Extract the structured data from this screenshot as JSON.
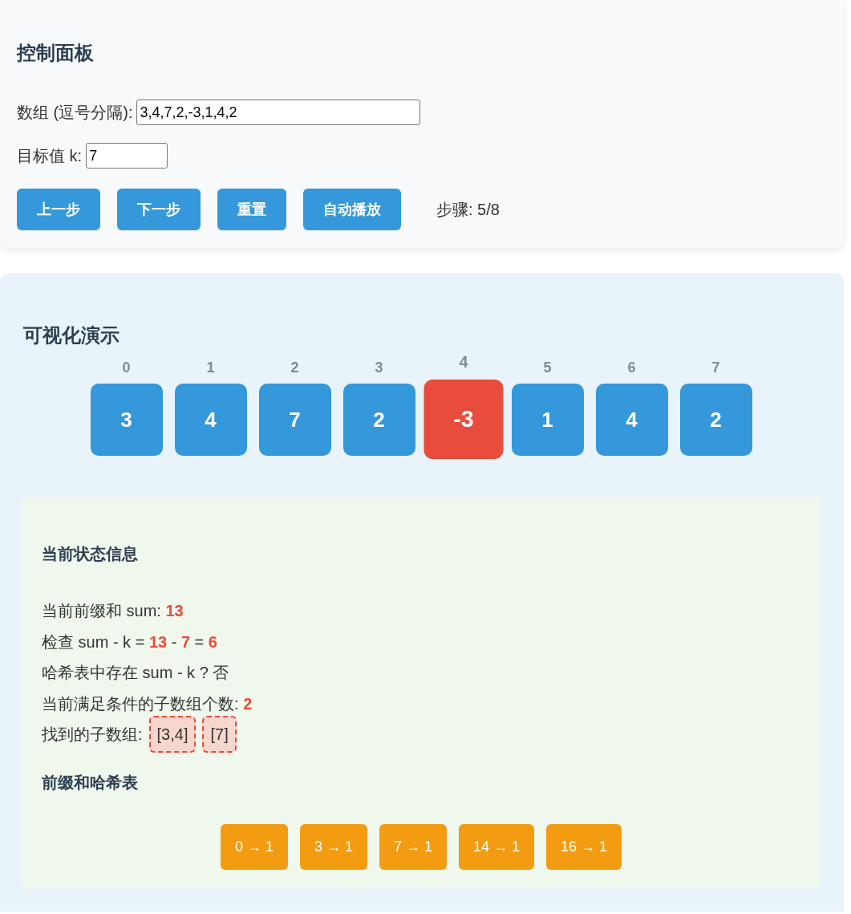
{
  "control_panel": {
    "title": "控制面板",
    "fields": [
      {
        "label": "数组 (逗号分隔):",
        "value": "3,4,7,2,-3,1,4,2"
      },
      {
        "label": "目标值 k:",
        "value": "7"
      }
    ],
    "buttons": [
      "上一步",
      "下一步",
      "重置",
      "自动播放"
    ],
    "step": "步骤: 5/8"
  },
  "visualization": {
    "title": "可视化演示",
    "array": [
      {
        "index": "0",
        "value": "3",
        "selected": false
      },
      {
        "index": "1",
        "value": "4",
        "selected": false
      },
      {
        "index": "2",
        "value": "7",
        "selected": false
      },
      {
        "index": "3",
        "value": "2",
        "selected": false
      },
      {
        "index": "4",
        "value": "-3",
        "selected": true
      },
      {
        "index": "5",
        "value": "1",
        "selected": false
      },
      {
        "index": "6",
        "value": "4",
        "selected": false
      },
      {
        "index": "7",
        "value": "2",
        "selected": false
      }
    ]
  },
  "state_info": {
    "title": "当前状态信息",
    "lines": [
      "当前前缀和 sum: **13**",
      "检查 sum - k = **13** - **7** = **6**",
      "哈希表中存在 sum - k ? 否",
      "当前满足条件的子数组个数: **2**"
    ],
    "found": {
      "label": "找到的子数组:",
      "subarrays": [
        "[3,4]",
        "[7]"
      ]
    }
  },
  "hash_table": {
    "title": "前缀和哈希表",
    "entries": [
      "0 → 1",
      "3 → 1",
      "7 → 1",
      "14 → 1",
      "16 → 1"
    ]
  }
}
